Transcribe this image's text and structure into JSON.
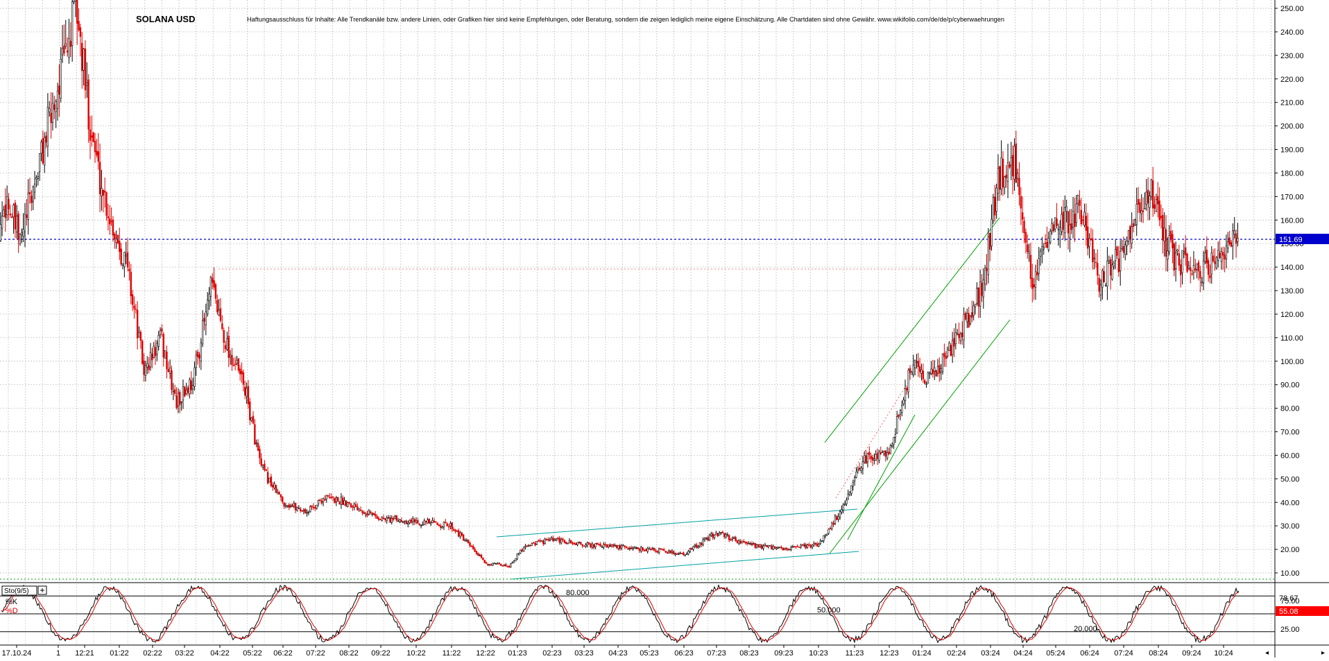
{
  "chart_data": {
    "type": "candlestick",
    "title": "SOLANA USD",
    "disclaimer": "Haftungsausschluss für Inhalte: Alle Trendkanäle bzw. andere Linien, oder Grafiken hier sind keine Empfehlungen, oder Beratung, sondern die zeigen lediglich meine eigene Einschätzung. Alle Chartdaten sind ohne Gewähr.  www.wikifolio.com/de/de/p/cyberwaehrungen",
    "y_ticks": [
      "250.00",
      "240.00",
      "230.00",
      "220.00",
      "210.00",
      "200.00",
      "190.00",
      "180.00",
      "170.00",
      "160.00",
      "150.00",
      "140.00",
      "130.00",
      "120.00",
      "110.00",
      "100.00",
      "90.00",
      "80.00",
      "70.00",
      "60.00",
      "50.00",
      "40.00",
      "30.00",
      "20.00",
      "10.00"
    ],
    "ylim": [
      5,
      254
    ],
    "x_ticks": [
      "17.10.24",
      "1",
      "12:21",
      "01:22",
      "02:22",
      "03:22",
      "04:22",
      "05:22",
      "06:22",
      "07:22",
      "08:22",
      "09:22",
      "10:22",
      "11:22",
      "12:22",
      "01:23",
      "02:23",
      "03:23",
      "04:23",
      "05:23",
      "06:23",
      "07:23",
      "08:23",
      "09:23",
      "10:23",
      "11:23",
      "12:23",
      "01:24",
      "02:24",
      "03:24",
      "04:24",
      "05:24",
      "06:24",
      "07:24",
      "08:24",
      "09:24",
      "10:24"
    ],
    "price_path": [
      [
        "11:21",
        140
      ],
      [
        "11:21",
        170
      ],
      [
        "11:21",
        150
      ],
      [
        "12:21",
        250
      ],
      [
        "12:21",
        210
      ],
      [
        "12:21",
        180
      ],
      [
        "01:22",
        160
      ],
      [
        "01:22",
        140
      ],
      [
        "02:22",
        95
      ],
      [
        "02:22",
        110
      ],
      [
        "03:22",
        82
      ],
      [
        "03:22",
        92
      ],
      [
        "04:22",
        132
      ],
      [
        "04:22",
        105
      ],
      [
        "05:22",
        90
      ],
      [
        "05:22",
        55
      ],
      [
        "06:22",
        40
      ],
      [
        "07:22",
        36
      ],
      [
        "07:22",
        42
      ],
      [
        "08:22",
        40
      ],
      [
        "09:22",
        33
      ],
      [
        "10:22",
        32
      ],
      [
        "11:22",
        30
      ],
      [
        "12:22",
        14
      ],
      [
        "01:23",
        13
      ],
      [
        "01:23",
        22
      ],
      [
        "02:23",
        24
      ],
      [
        "03:23",
        22
      ],
      [
        "04:23",
        21
      ],
      [
        "05:23",
        20
      ],
      [
        "06:23",
        18
      ],
      [
        "07:23",
        27
      ],
      [
        "08:23",
        22
      ],
      [
        "09:23",
        20
      ],
      [
        "10:23",
        22
      ],
      [
        "11:23",
        40
      ],
      [
        "11:23",
        58
      ],
      [
        "12:23",
        62
      ],
      [
        "01:24",
        100
      ],
      [
        "01:24",
        92
      ],
      [
        "02:24",
        110
      ],
      [
        "03:24",
        130
      ],
      [
        "03:24",
        180
      ],
      [
        "04:24",
        185
      ],
      [
        "04:24",
        135
      ],
      [
        "05:24",
        155
      ],
      [
        "06:24",
        165
      ],
      [
        "06:24",
        135
      ],
      [
        "07:24",
        145
      ],
      [
        "08:24",
        175
      ],
      [
        "08:24",
        148
      ],
      [
        "09:24",
        138
      ],
      [
        "10:24",
        142
      ],
      [
        "10:24",
        151.69
      ]
    ],
    "current_price": "151.69",
    "horizontal_levels": [
      151.69,
      139
    ],
    "oscillator": {
      "name": "Sto(9/5)",
      "series": [
        "%K",
        "%D"
      ],
      "k_value": "78.67",
      "d_value": "55.08",
      "levels": [
        "80.000",
        "50.000",
        "20.000"
      ],
      "axis_ticks": [
        "75.00",
        "25.00"
      ],
      "ylim": [
        0,
        100
      ]
    },
    "grid": true,
    "colors": {
      "up": "#000000",
      "down": "#e00000",
      "current_line": "#0000cc",
      "support_line": "#ff8080",
      "trend_channel": "#00a000",
      "range_channel": "#00a0a0",
      "k_line": "#000000",
      "d_line": "#dd0000",
      "price_badge": "#0000cc",
      "d_badge": "#ff0000"
    }
  }
}
